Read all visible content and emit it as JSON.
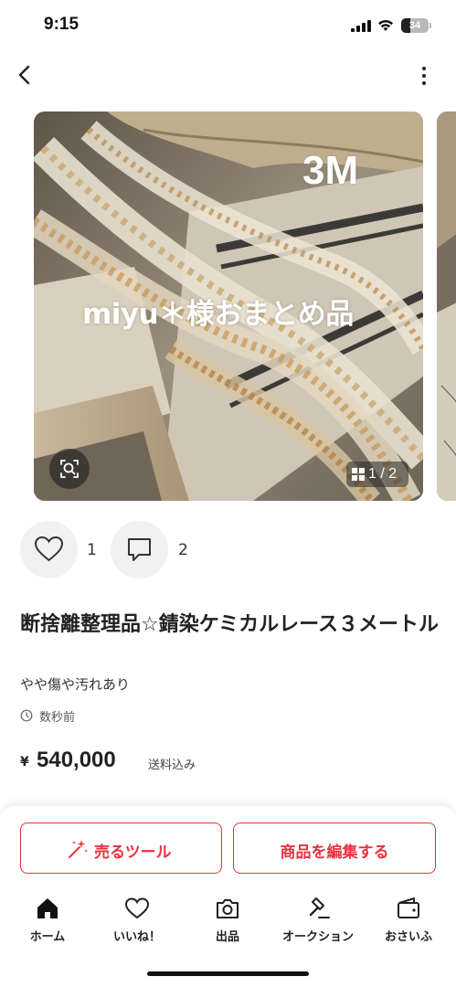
{
  "status_bar": {
    "time": "9:15",
    "battery": "34",
    "battery_level": 0.34
  },
  "photo": {
    "overlay_size_text": "3M",
    "overlay_title_text": "miyu＊様おまとめ品",
    "page_counter": "1 / 2"
  },
  "actions": {
    "like_count": "1",
    "comment_count": "2"
  },
  "product": {
    "title": "断捨離整理品☆錆染ケミカルレース３メートル",
    "condition": "やや傷や汚れあり",
    "listed_time": "数秒前",
    "price_currency": "¥",
    "price": "540,000",
    "shipping": "送料込み"
  },
  "buttons": {
    "sell_tool": "売るツール",
    "edit_item": "商品を編集する"
  },
  "tab_bar": {
    "tabs": [
      {
        "label": "ホーム",
        "icon": "home-icon"
      },
      {
        "label": "いいね！",
        "icon": "heart-icon"
      },
      {
        "label": "出品",
        "icon": "camera-icon"
      },
      {
        "label": "オークション",
        "icon": "gavel-icon"
      },
      {
        "label": "おさいふ",
        "icon": "wallet-icon"
      }
    ]
  },
  "colors": {
    "accent": "#e4353f",
    "text": "#222222",
    "muted": "#f1f1f1"
  }
}
